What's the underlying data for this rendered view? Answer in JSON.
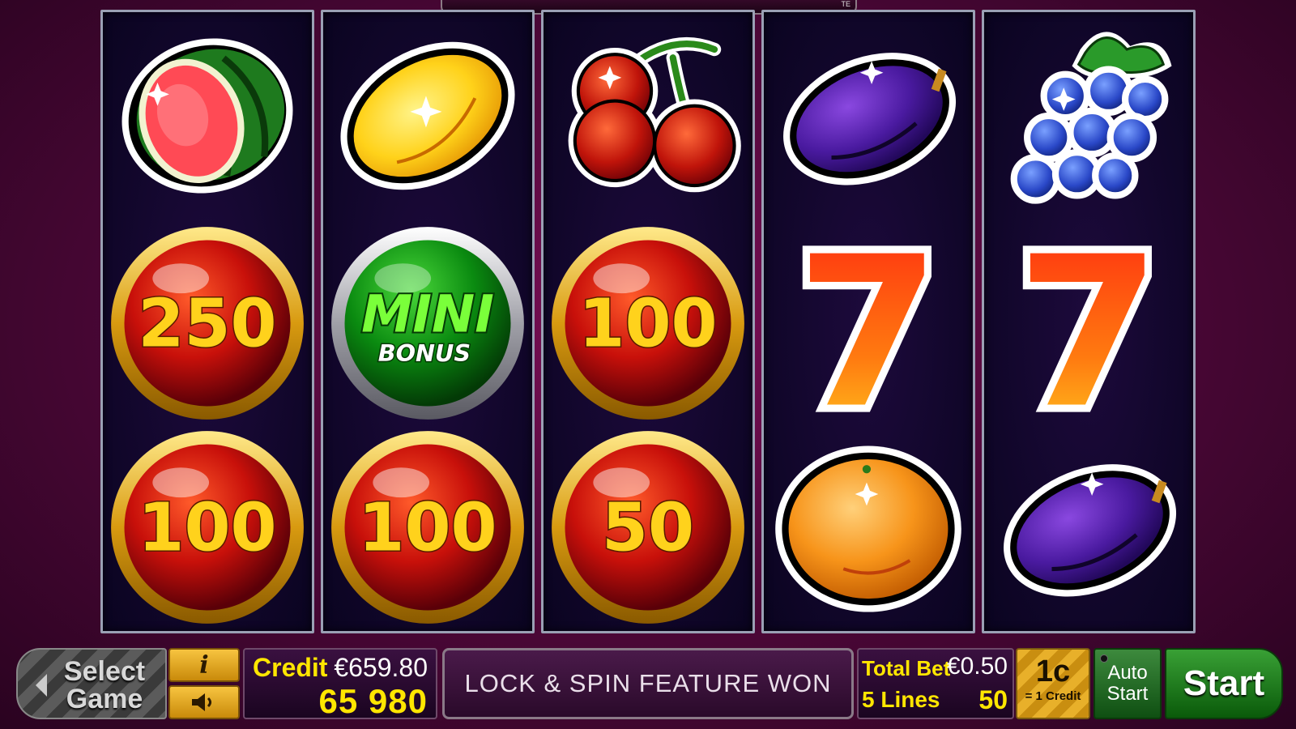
{
  "reels": [
    [
      "watermelon",
      "coin-250",
      "coin-100"
    ],
    [
      "lemon",
      "mini-bonus",
      "coin-100"
    ],
    [
      "cherries",
      "coin-100",
      "coin-50"
    ],
    [
      "plum",
      "seven",
      "orange"
    ],
    [
      "grapes",
      "seven",
      "plum"
    ]
  ],
  "coins": {
    "c250": "250",
    "c100": "100",
    "c50": "50"
  },
  "mini_bonus": {
    "line1": "MINI",
    "line2": "BONUS"
  },
  "seven_glyph": "7",
  "top_indicator": "TE",
  "controls": {
    "select_game_line1": "Select",
    "select_game_line2": "Game",
    "info_label": "i",
    "credit_label": "Credit",
    "credit_money": "€659.80",
    "credit_count": "65 980",
    "message": "LOCK & SPIN FEATURE WON",
    "total_bet_label": "Total Bet",
    "total_bet_value": "€0.50",
    "lines_label": "5 Lines",
    "lines_value": "50",
    "denom_main": "1c",
    "denom_sub": "= 1 Credit",
    "auto_line1": "Auto",
    "auto_line2": "Start",
    "start_label": "Start"
  },
  "colors": {
    "background": "#4a0736",
    "reel_bg": "#0a0420",
    "accent_yellow": "#ffe600",
    "start_green": "#1a7a1a"
  }
}
